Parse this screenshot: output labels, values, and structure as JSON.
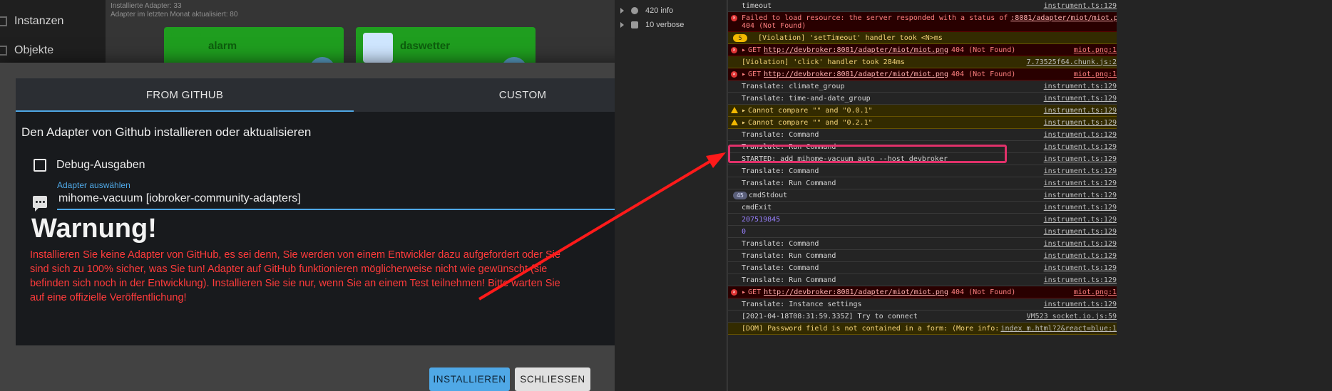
{
  "app": {
    "sidebar": [
      {
        "label": "Instanzen"
      },
      {
        "label": "Objekte"
      }
    ],
    "info_lines": [
      "Installierte Adapter: 33",
      "Adapter im letzten Monat aktualisiert: 80"
    ],
    "tiles": [
      {
        "name": "alarm"
      },
      {
        "name": "daswetter"
      }
    ]
  },
  "dialog": {
    "tabs": [
      {
        "label": "FROM GITHUB",
        "active": true
      },
      {
        "label": "CUSTOM",
        "active": false
      }
    ],
    "heading": "Den Adapter von Github installieren oder aktualisieren",
    "debug_label": "Debug-Ausgaben",
    "select_label": "Adapter auswählen",
    "select_value": "mihome-vacuum [iobroker-community-adapters]",
    "warning_title": "Warnung!",
    "warning_text": "Installieren Sie keine Adapter von GitHub, es sei denn, Sie werden von einem Entwickler dazu aufgefordert oder Sie sind sich zu 100% sicher, was Sie tun! Adapter auf GitHub funktionieren möglicherweise nicht wie gewünscht (sie befinden sich noch in der Entwicklung). Installieren Sie sie nur, wenn Sie an einem Test teilnehmen! Bitte warten Sie auf eine offizielle Veröffentlichung!",
    "install_label": "INSTALLIEREN",
    "close_label": "SCHLIESSEN"
  },
  "devtools": {
    "sidebar": [
      {
        "label": "420 info"
      },
      {
        "label": "10 verbose"
      }
    ],
    "rows": [
      {
        "type": "plain",
        "text": "timeout",
        "src": "instrument.ts:129"
      },
      {
        "type": "err2",
        "line1": "Failed to load resource: the server responded with a status of",
        "link": ":8081/adapter/miot/miot.png:1",
        "line2": "404 (Not Found)"
      },
      {
        "type": "warncount",
        "count": "5",
        "text": "[Violation] 'setTimeout' handler took <N>ms",
        "src": ""
      },
      {
        "type": "errget",
        "pre": "GET",
        "link": "http://devbroker:8081/adapter/miot/miot.png",
        "post": "404 (Not Found)",
        "src": "miot.png:1"
      },
      {
        "type": "warnplain",
        "text": "[Violation] 'click' handler took 284ms",
        "src": "7.73525f64.chunk.js:2"
      },
      {
        "type": "errget",
        "pre": "GET",
        "link": "http://devbroker:8081/adapter/miot/miot.png",
        "post": "404 (Not Found)",
        "src": "miot.png:1"
      },
      {
        "type": "plain",
        "text": "Translate: climate_group",
        "src": "instrument.ts:129"
      },
      {
        "type": "plain",
        "text": "Translate: time-and-date_group",
        "src": "instrument.ts:129"
      },
      {
        "type": "warn",
        "text": "Cannot compare \"\" and \"0.0.1\"",
        "src": "instrument.ts:129"
      },
      {
        "type": "warn",
        "text": "Cannot compare \"\" and \"0.2.1\"",
        "src": "instrument.ts:129"
      },
      {
        "type": "plain",
        "text": "Translate: Command",
        "src": "instrument.ts:129"
      },
      {
        "type": "plain",
        "text": "Translate: Run Command",
        "src": "instrument.ts:129"
      },
      {
        "type": "plain",
        "text": "STARTED: add mihome-vacuum auto --host devbroker",
        "src": "instrument.ts:129"
      },
      {
        "type": "plain",
        "text": "Translate: Command",
        "src": "instrument.ts:129"
      },
      {
        "type": "plain",
        "text": "Translate: Run Command",
        "src": "instrument.ts:129"
      },
      {
        "type": "count",
        "count": "45",
        "text": "cmdStdout",
        "src": "instrument.ts:129"
      },
      {
        "type": "plain",
        "text": "cmdExit",
        "src": "instrument.ts:129"
      },
      {
        "type": "num",
        "text": "207519845",
        "src": "instrument.ts:129"
      },
      {
        "type": "num",
        "text": "0",
        "src": "instrument.ts:129"
      },
      {
        "type": "plain",
        "text": "Translate: Command",
        "src": "instrument.ts:129"
      },
      {
        "type": "plain",
        "text": "Translate: Run Command",
        "src": "instrument.ts:129"
      },
      {
        "type": "plain",
        "text": "Translate: Command",
        "src": "instrument.ts:129"
      },
      {
        "type": "plain",
        "text": "Translate: Run Command",
        "src": "instrument.ts:129"
      },
      {
        "type": "errget",
        "pre": "GET",
        "link": "http://devbroker:8081/adapter/miot/miot.png",
        "post": "404 (Not Found)",
        "src": "miot.png:1"
      },
      {
        "type": "plain",
        "text": "Translate: Instance settings",
        "src": "instrument.ts:129"
      },
      {
        "type": "plain",
        "text": "[2021-04-18T08:31:59.335Z] Try to connect",
        "src": "VM523 socket.io.js:59"
      },
      {
        "type": "warnplain",
        "text": "[DOM] Password field is not contained in a form: (More info: htt",
        "src": "index m.html?2&react=blue:1"
      }
    ]
  }
}
